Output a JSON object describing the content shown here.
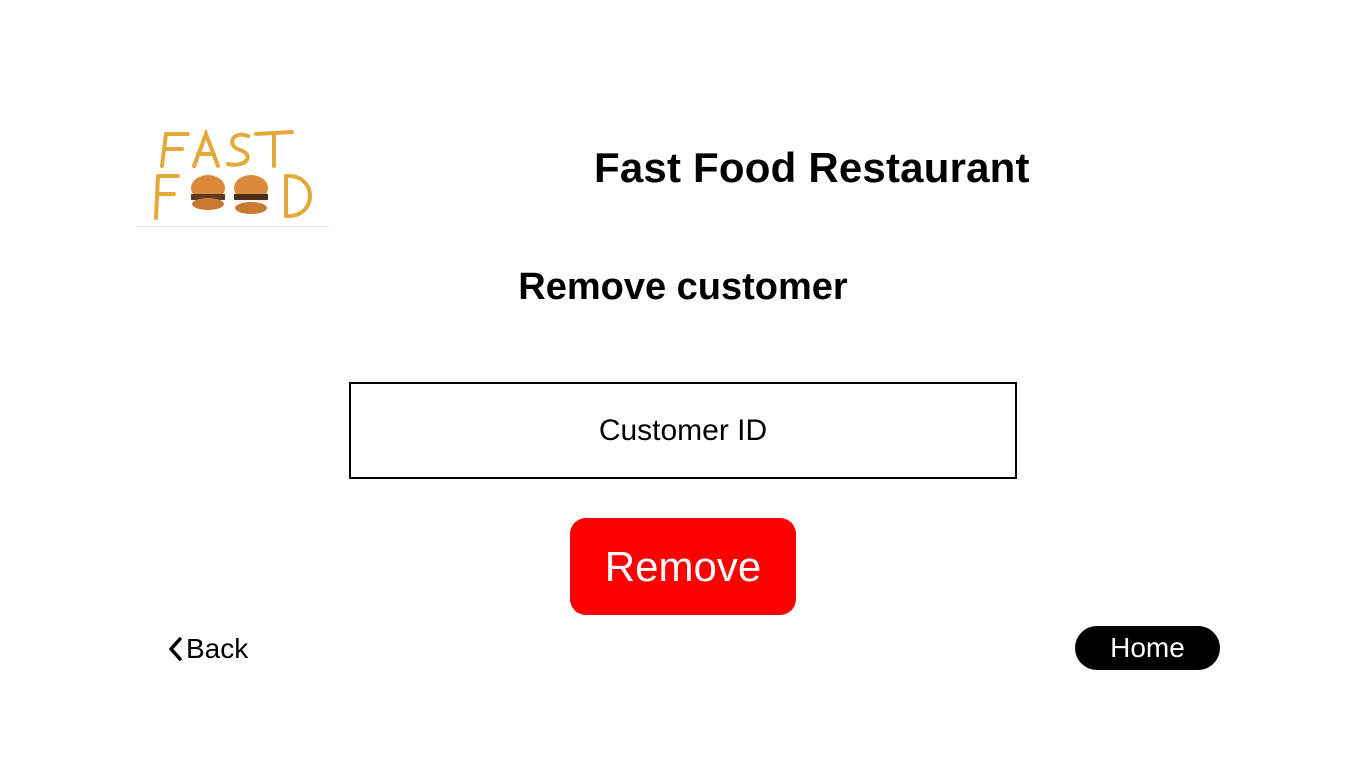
{
  "header": {
    "logo_text": "FAST FOOD",
    "app_title": "Fast Food Restaurant"
  },
  "main": {
    "page_title": "Remove customer",
    "customer_id_field": {
      "placeholder": "Customer ID",
      "value": ""
    },
    "remove_button_label": "Remove"
  },
  "footer": {
    "back_label": "Back",
    "home_label": "Home"
  },
  "colors": {
    "remove_button": "#ff0000",
    "home_button": "#000000"
  },
  "icons": {
    "back": "chevron-left-icon",
    "logo": "fast-food-logo"
  }
}
